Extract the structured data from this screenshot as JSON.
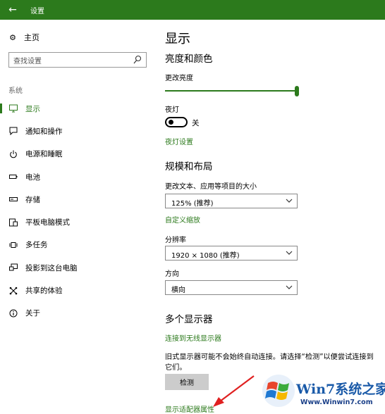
{
  "window": {
    "title": "设置",
    "back_icon": "back-arrow-icon",
    "accent": "#2c7a1c"
  },
  "sidebar": {
    "home_label": "主页",
    "search_placeholder": "查找设置",
    "section_label": "系统",
    "items": [
      {
        "label": "显示",
        "icon": "display-icon",
        "active": true
      },
      {
        "label": "通知和操作",
        "icon": "notification-icon"
      },
      {
        "label": "电源和睡眠",
        "icon": "power-icon"
      },
      {
        "label": "电池",
        "icon": "battery-icon"
      },
      {
        "label": "存储",
        "icon": "storage-icon"
      },
      {
        "label": "平板电脑模式",
        "icon": "tablet-mode-icon"
      },
      {
        "label": "多任务",
        "icon": "multitasking-icon"
      },
      {
        "label": "投影到这台电脑",
        "icon": "project-icon"
      },
      {
        "label": "共享的体验",
        "icon": "shared-experiences-icon"
      },
      {
        "label": "关于",
        "icon": "about-icon"
      }
    ]
  },
  "main": {
    "page_title": "显示",
    "brightness_section": "亮度和颜色",
    "brightness_label": "更改亮度",
    "brightness_level": 1.0,
    "night_light_label": "夜灯",
    "night_light_state": "关",
    "night_light_settings_link": "夜灯设置",
    "scale_section": "规模和布局",
    "scale_label": "更改文本、应用等项目的大小",
    "scale_value": "125% (推荐)",
    "custom_scale_link": "自定义缩放",
    "resolution_label": "分辨率",
    "resolution_value": "1920 × 1080 (推荐)",
    "orientation_label": "方向",
    "orientation_value": "横向",
    "multi_display_section": "多个显示器",
    "wireless_link": "连接到无线显示器",
    "detect_desc": "旧式显示器可能不会始终自动连接。请选择“检测”以便尝试连接到它们。",
    "detect_button": "检测",
    "adapter_link": "显示适配器属性"
  },
  "watermark": {
    "brand": "Win7系统之家",
    "url": "Www.Winwin7.com"
  }
}
